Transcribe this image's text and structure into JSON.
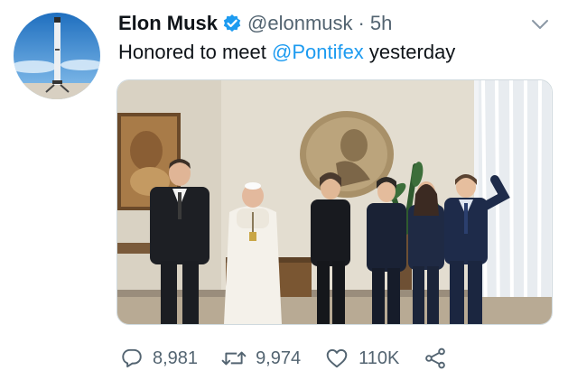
{
  "author": {
    "name": "Elon Musk",
    "handle": "@elonmusk",
    "separator": "·",
    "time": "5h"
  },
  "tweet": {
    "text_before": "Honored to meet ",
    "mention": "@Pontifex",
    "text_after": " yesterday"
  },
  "stats": {
    "replies": "8,981",
    "retweets": "9,974",
    "likes": "110K"
  },
  "icons": {
    "avatar": "rocket-avatar",
    "verified": "verified-badge-icon",
    "menu": "chevron-down-icon",
    "reply": "reply-icon",
    "retweet": "retweet-icon",
    "like": "heart-icon",
    "share": "share-icon"
  },
  "colors": {
    "accent": "#1d9bf0",
    "text": "#0f1419",
    "secondary": "#536471"
  }
}
